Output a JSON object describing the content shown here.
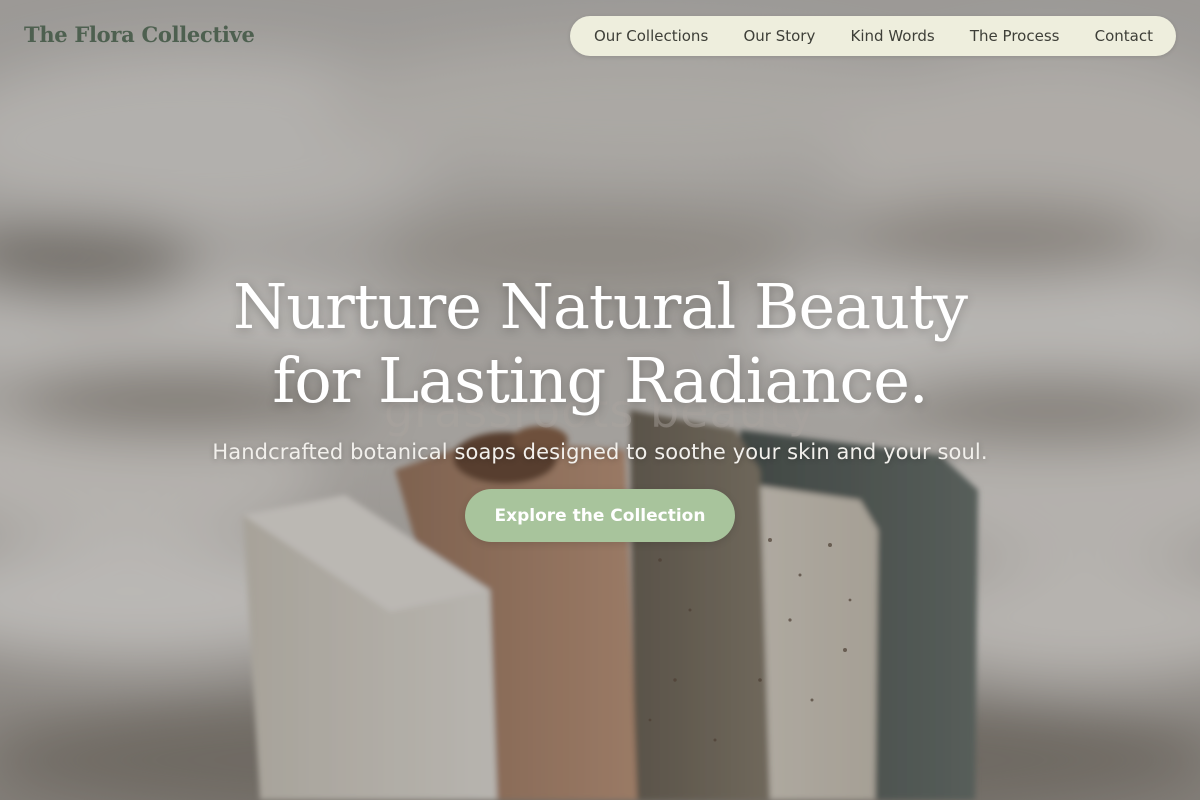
{
  "brand": {
    "name": "The Flora Collective"
  },
  "nav": {
    "items": [
      {
        "label": "Our Collections"
      },
      {
        "label": "Our Story"
      },
      {
        "label": "Kind Words"
      },
      {
        "label": "The Process"
      },
      {
        "label": "Contact"
      }
    ]
  },
  "hero": {
    "headline_line1": "Nurture Natural Beauty",
    "headline_line2": "for Lasting Radiance.",
    "ghost_text": "grassroots beauty",
    "subheadline": "Handcrafted botanical soaps designed to soothe your skin and your soul.",
    "cta_label": "Explore the Collection"
  },
  "colors": {
    "brand_text": "#4e6050",
    "nav_background": "#eeeedd",
    "cta_background": "#a8c49c",
    "headline": "#ffffff"
  }
}
